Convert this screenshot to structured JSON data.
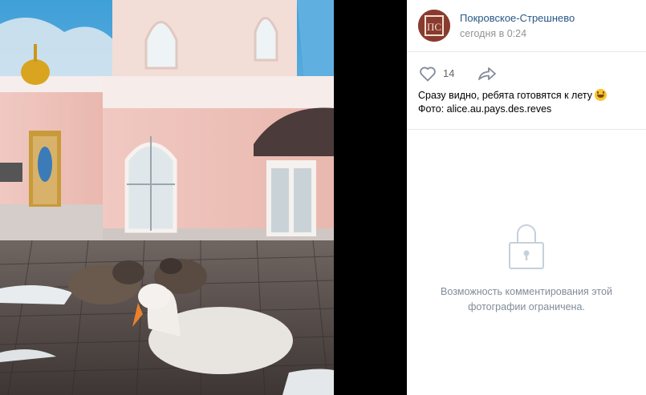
{
  "post": {
    "author": "Покровское-Стрешнево",
    "date": "сегодня в 0:24",
    "avatar_text": "ПС",
    "caption_line1": "Сразу видно, ребята готовятся к лету",
    "caption_line2": "Фото: alice.au.pays.des.reves"
  },
  "actions": {
    "likes": "14",
    "like_icon": "heart-icon",
    "share_icon": "share-arrow-icon"
  },
  "comments": {
    "restricted_text": "Возможность комментирования этой фотографии ограничена.",
    "icon": "lock-icon"
  },
  "colors": {
    "link": "#2a5885",
    "muted": "#939393",
    "comment_text": "#818c99",
    "divider": "#e7e8ec",
    "photo_bg": "#000000"
  }
}
